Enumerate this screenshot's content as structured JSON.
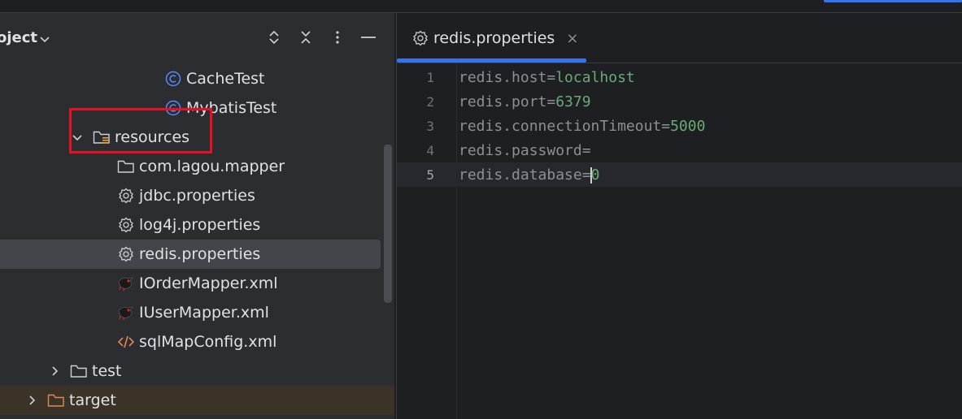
{
  "project_panel": {
    "title": "oject",
    "tree": [
      {
        "label": "CacheTest",
        "icon": "class-icon"
      },
      {
        "label": "MybatisTest",
        "icon": "class-icon"
      },
      {
        "label": "resources",
        "icon": "resources-folder-icon"
      },
      {
        "label": "com.lagou.mapper",
        "icon": "folder-icon"
      },
      {
        "label": "jdbc.properties",
        "icon": "properties-icon"
      },
      {
        "label": "log4j.properties",
        "icon": "properties-icon"
      },
      {
        "label": "redis.properties",
        "icon": "properties-icon",
        "selected": true
      },
      {
        "label": "IOrderMapper.xml",
        "icon": "mybatis-icon"
      },
      {
        "label": "IUserMapper.xml",
        "icon": "mybatis-icon"
      },
      {
        "label": "sqlMapConfig.xml",
        "icon": "xml-icon"
      },
      {
        "label": "test",
        "icon": "folder-icon"
      },
      {
        "label": "target",
        "icon": "folder-icon"
      }
    ]
  },
  "editor": {
    "tab": {
      "label": "redis.properties",
      "close": "×"
    },
    "lines": [
      {
        "no": "1",
        "key": "redis.host",
        "eq": "=",
        "value": "localhost"
      },
      {
        "no": "2",
        "key": "redis.port",
        "eq": "=",
        "value": "6379"
      },
      {
        "no": "3",
        "key": "redis.connectionTimeout",
        "eq": "=",
        "value": "5000"
      },
      {
        "no": "4",
        "key": "redis.password",
        "eq": "=",
        "value": ""
      },
      {
        "no": "5",
        "key": "redis.database",
        "eq": "=",
        "value": "0"
      }
    ],
    "current_line": 5
  },
  "colors": {
    "accent": "#3574f0",
    "annotation_box": "#e81123",
    "value_green": "#6aab73"
  }
}
